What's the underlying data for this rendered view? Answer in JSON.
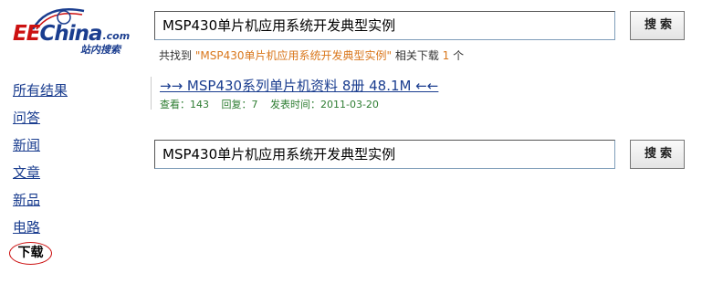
{
  "logo": {
    "ee": "EE",
    "china": "China",
    "com": ".com",
    "sub": "站内搜索"
  },
  "search_top": {
    "value": "MSP430单片机应用系统开发典型实例",
    "button": "搜索"
  },
  "summary": {
    "prefix": "共找到",
    "keyword": "\"MSP430单片机应用系统开发典型实例\"",
    "middle": "相关下载",
    "count": "1",
    "suffix": "个"
  },
  "nav": {
    "items": [
      "所有结果",
      "问答",
      "新闻",
      "文章",
      "新品",
      "电路"
    ],
    "active": "下载"
  },
  "result": {
    "title": "→→ MSP430系列单片机资料 8册 48.1M ←←",
    "views": "查看：143",
    "replies": "回复：7",
    "date": "发表时间：2011-03-20"
  },
  "search_bottom": {
    "value": "MSP430单片机应用系统开发典型实例",
    "button": "搜索"
  },
  "colors": {
    "link": "#1a3d8f",
    "accent": "#d9771c",
    "meta": "#2e7d32",
    "logo_red": "#cc1111"
  }
}
